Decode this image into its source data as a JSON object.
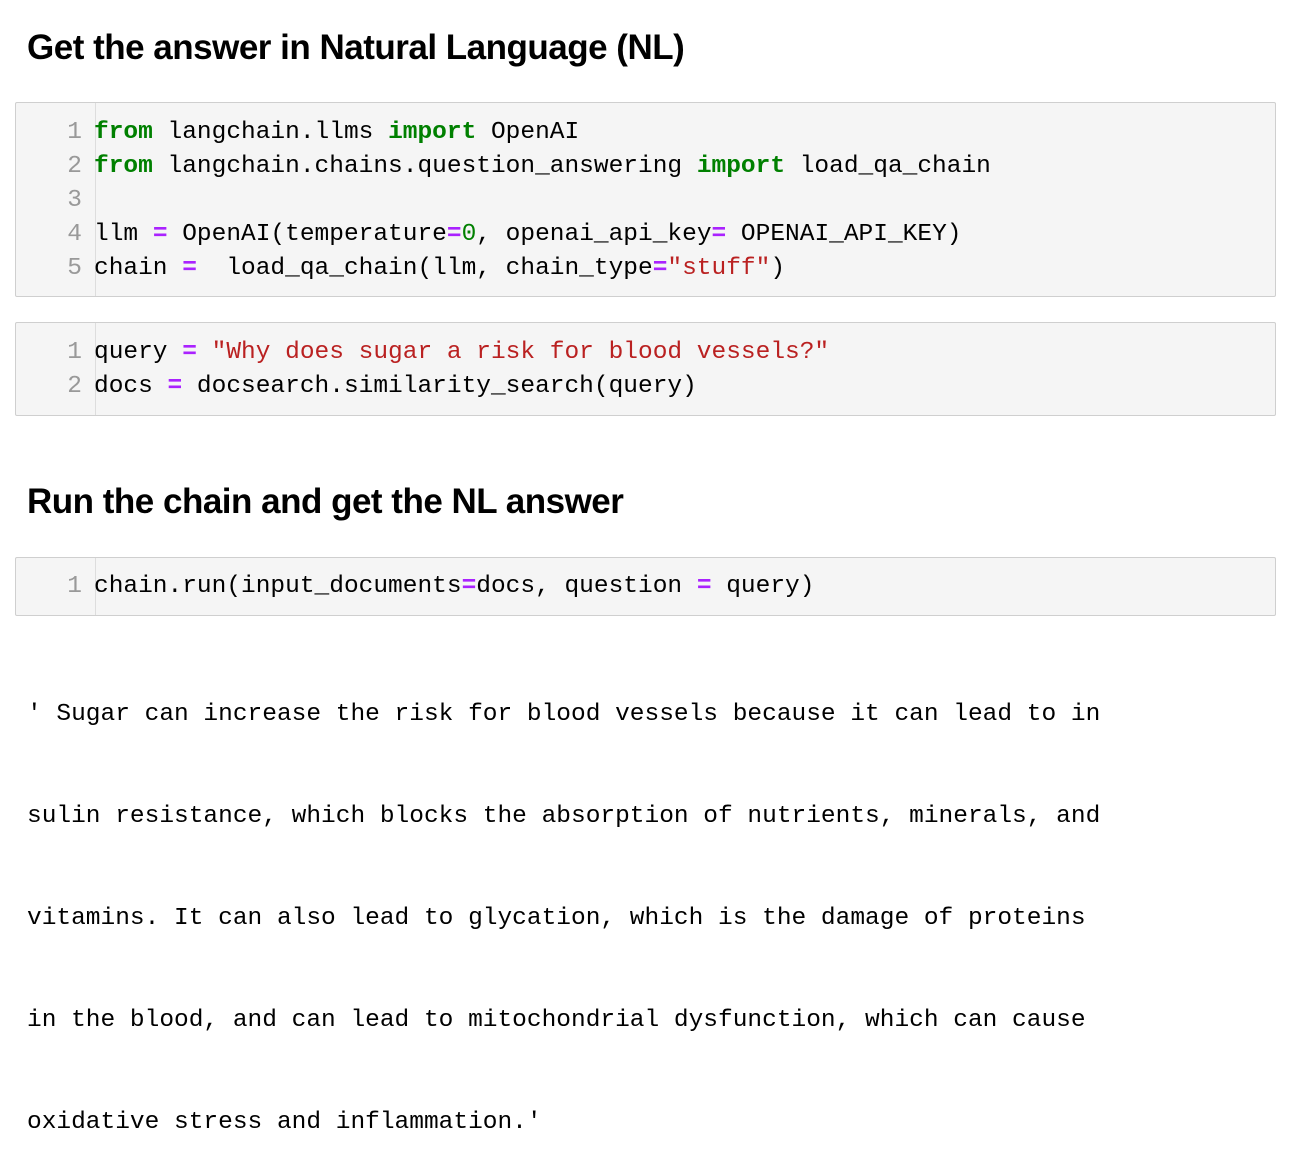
{
  "headings": {
    "section1": "Get the answer in Natural Language (NL)",
    "section2": "Run the chain and get the NL answer"
  },
  "cell1": {
    "line_numbers": [
      "1",
      "2",
      "3",
      "4",
      "5"
    ],
    "lines": {
      "l1": {
        "kw_from": "from",
        "mod": " langchain.llms ",
        "kw_import": "import",
        "name": " OpenAI"
      },
      "l2": {
        "kw_from": "from",
        "mod": " langchain.chains.question_answering ",
        "kw_import": "import",
        "name": " load_qa_chain"
      },
      "l4": {
        "var": "llm ",
        "eq": "=",
        "call": " OpenAI(temperature",
        "eq2": "=",
        "num": "0",
        "mid": ", openai_api_key",
        "eq3": "=",
        "tail": " OPENAI_API_KEY)"
      },
      "l5": {
        "var": "chain ",
        "eq": "=",
        "call": "  load_qa_chain(llm, chain_type",
        "eq2": "=",
        "str": "\"stuff\"",
        "tail": ")"
      }
    }
  },
  "cell2": {
    "line_numbers": [
      "1",
      "2"
    ],
    "lines": {
      "l1": {
        "var": "query ",
        "eq": "=",
        "sp": " ",
        "str": "\"Why does sugar a risk for blood vessels?\""
      },
      "l2": {
        "var": "docs ",
        "eq": "=",
        "tail": " docsearch.similarity_search(query)"
      }
    }
  },
  "cell3": {
    "line_numbers": [
      "1"
    ],
    "lines": {
      "l1": {
        "a": "chain.run(input_documents",
        "eq": "=",
        "b": "docs, question ",
        "eq2": "=",
        "c": " query)"
      }
    }
  },
  "output": {
    "lines": [
      "' Sugar can increase the risk for blood vessels because it can lead to in",
      "sulin resistance, which blocks the absorption of nutrients, minerals, and",
      "vitamins. It can also lead to glycation, which is the damage of proteins",
      "in the blood, and can lead to mitochondrial dysfunction, which can cause",
      "oxidative stress and inflammation.'"
    ]
  }
}
